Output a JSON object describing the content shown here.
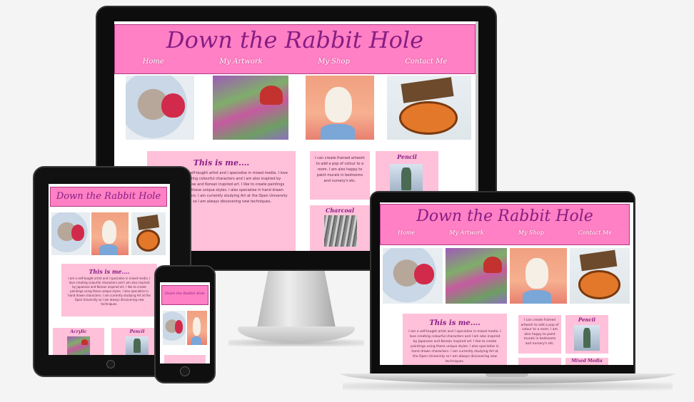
{
  "site": {
    "title": "Down the Rabbit Hole",
    "nav": [
      "Home",
      "My Artwork",
      "My Shop",
      "Contact Me"
    ],
    "about_title": "This is me....",
    "about_text": "I am a self-taught artist and I specialise in mixed media. I love creating colourful characters and I am also inspired by Japanese and Korean inspired art. I like to create paintings using these unique styles. I also specialise in hand drawn characters. I am currently studying Art at the Open University so I am always discovering new techniques.",
    "commission_text": "I can create framed artwork to add a pop of colour to a room. I am also happy to paint murals in bedrooms and nursery's etc.",
    "pencil_title": "Pencil",
    "charcoal_title": "Charcoal",
    "acrylic_title": "Acrylic",
    "mixed_media_title": "Mixed Media"
  },
  "colors": {
    "header_pink": "#ff80c4",
    "card_pink": "#ffc0d9",
    "title_purple": "#861d84"
  },
  "icons": [
    "home-button-icon",
    "camera-icon"
  ]
}
